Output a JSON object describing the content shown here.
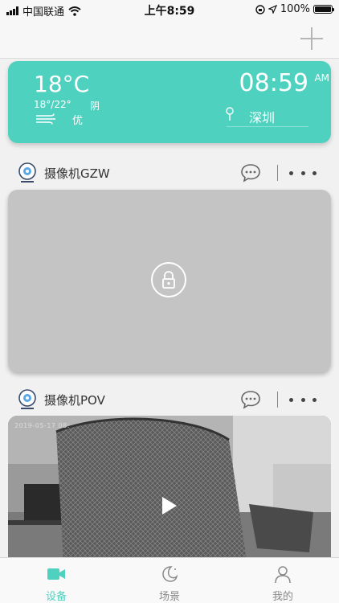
{
  "status_bar": {
    "carrier": "中国联通",
    "time": "上午8:59",
    "battery_percent": "100%",
    "battery_level": 1.0
  },
  "weather": {
    "temperature": "18°C",
    "temp_range": "18°/22°",
    "condition": "阴",
    "air_quality": "优",
    "time": "08:59",
    "am_pm": "AM",
    "city": "深圳"
  },
  "cameras": [
    {
      "name": "摄像机GZW",
      "status": "locked"
    },
    {
      "name": "摄像机POV",
      "timestamp": "2019-05-17 08:",
      "status": "live"
    }
  ],
  "tabs": [
    {
      "label": "设备",
      "icon": "video-camera-icon",
      "active": true
    },
    {
      "label": "场景",
      "icon": "moon-icon",
      "active": false
    },
    {
      "label": "我的",
      "icon": "person-icon",
      "active": false
    }
  ],
  "colors": {
    "accent": "#4fd1c0",
    "locked_view": "#c4c4c4",
    "inactive_tab": "#888888"
  }
}
